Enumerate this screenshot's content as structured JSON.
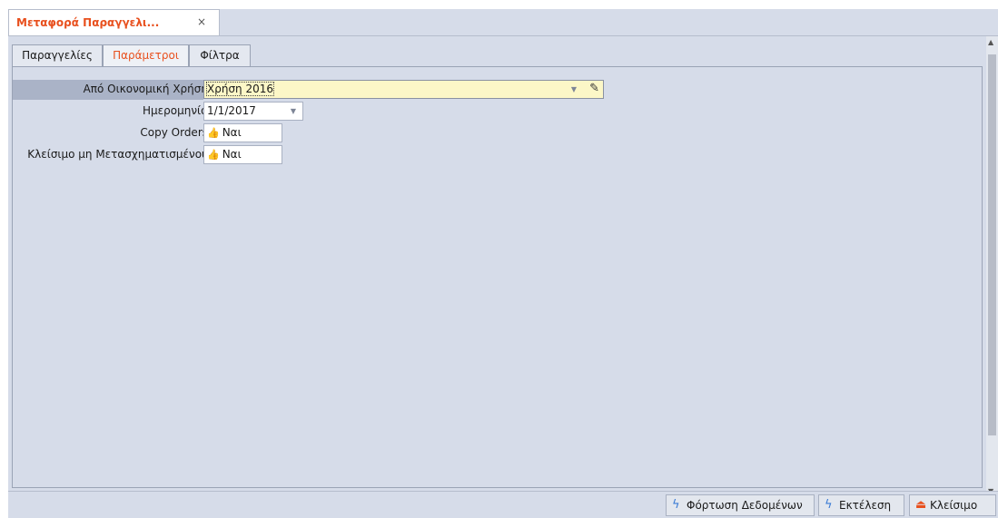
{
  "document_tab": {
    "title": "Μεταφορά Παραγγελι...",
    "close": "×"
  },
  "subtabs": [
    "Παραγγελίες",
    "Παράμετροι",
    "Φίλτρα"
  ],
  "form": {
    "from_fiscal_year_label": "Από Οικονομική Χρήση",
    "from_fiscal_year_value": "Χρήση 2016",
    "date_label": "Ημερομηνία",
    "date_value": "1/1/2017",
    "copy_orders_label": "Copy Orders",
    "copy_orders_value": "Ναι",
    "close_untransformed_label": "Κλείσιμο μη Μετασχηματισμένου",
    "close_untransformed_value": "Ναι"
  },
  "footer": {
    "load_data": "Φόρτωση Δεδομένων",
    "execute": "Εκτέλεση",
    "close": "Κλείσιμο"
  },
  "colors": {
    "accent": "#e8501e",
    "highlight_field": "#fcf7c7",
    "background": "#d6dce9"
  },
  "icons": [
    "close-icon",
    "dropdown-icon",
    "pencil-icon",
    "thumbs-up-icon",
    "bolt-icon",
    "eject-icon"
  ]
}
